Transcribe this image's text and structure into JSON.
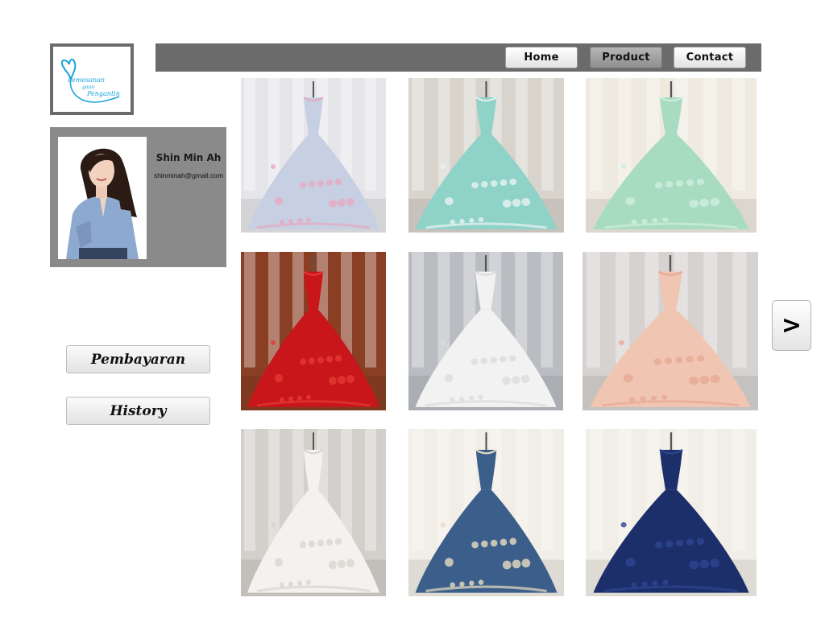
{
  "logo": {
    "line1": "Pemesanan",
    "line2": "gaun",
    "line3": "Pengantin",
    "color": "#1aa3d9"
  },
  "nav": {
    "home": "Home",
    "product": "Product",
    "contact": "Contact",
    "active": "Product"
  },
  "profile": {
    "name": "Shin Min Ah",
    "email": "shinminah@gmail.com"
  },
  "sidebar": {
    "payment": "Pembayaran",
    "history": "History"
  },
  "pager": {
    "next": ">"
  },
  "products": [
    {
      "name": "pastel-floral-ball-gown",
      "skirt": "#c7cfe3",
      "accent": "#e7a9c0",
      "bg": "#e6e6ea"
    },
    {
      "name": "mint-satin-gown",
      "skirt": "#8fd3c8",
      "accent": "#e9f3f1",
      "bg": "#d8d4cc"
    },
    {
      "name": "mint-tulle-gown",
      "skirt": "#a8dcc0",
      "accent": "#cfeedd",
      "bg": "#efeae0"
    },
    {
      "name": "red-ball-gown",
      "skirt": "#c8161b",
      "accent": "#e23a33",
      "bg": "#8a3e24"
    },
    {
      "name": "white-mermaid-gown",
      "skirt": "#f2f2f2",
      "accent": "#dcdcdc",
      "bg": "#b9bcc0"
    },
    {
      "name": "peach-ruffle-gown",
      "skirt": "#f0c6b2",
      "accent": "#e7a994",
      "bg": "#d6d2cf"
    },
    {
      "name": "white-sparkle-gown",
      "skirt": "#f4f2ef",
      "accent": "#d9d4cf",
      "bg": "#d3cfca"
    },
    {
      "name": "blue-embroidered-gown",
      "skirt": "#3b5f8a",
      "accent": "#e8dcc0",
      "bg": "#f1ede7"
    },
    {
      "name": "navy-ball-gown",
      "skirt": "#1d2f6b",
      "accent": "#2e4590",
      "bg": "#f1ede7"
    }
  ]
}
